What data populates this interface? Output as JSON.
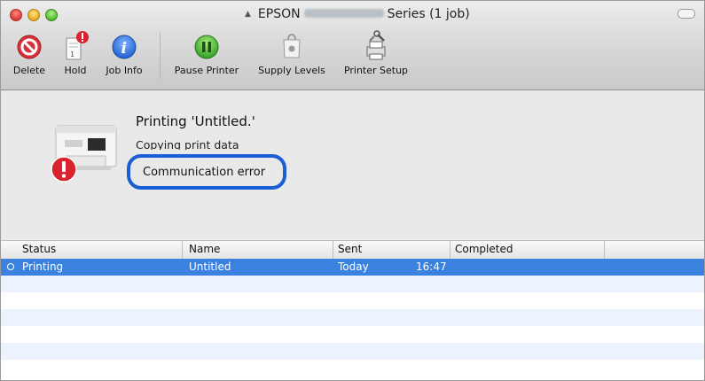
{
  "window": {
    "title_prefix": "EPSON",
    "title_suffix": "Series (1 job)"
  },
  "toolbar": {
    "delete_label": "Delete",
    "hold_label": "Hold",
    "job_info_label": "Job Info",
    "pause_label": "Pause Printer",
    "supply_label": "Supply Levels",
    "setup_label": "Printer Setup"
  },
  "job": {
    "title": "Printing 'Untitled.'",
    "status": "Copying print data",
    "error": "Communication error"
  },
  "table": {
    "columns": [
      "Status",
      "Name",
      "Sent",
      "Completed"
    ],
    "rows": [
      {
        "status": "Printing",
        "name": "Untitled",
        "sent_day": "Today",
        "sent_time": "16:47",
        "completed": ""
      }
    ]
  },
  "colors": {
    "selection": "#3b82e0",
    "highlight_ring": "#1a5fd6",
    "error_badge": "#d9232e"
  }
}
